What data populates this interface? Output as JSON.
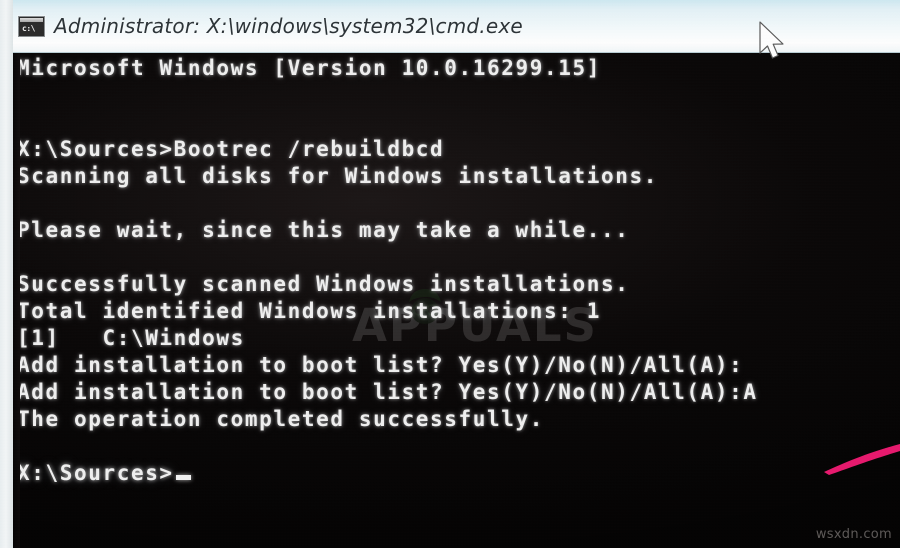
{
  "window": {
    "title": "Administrator: X:\\windows\\system32\\cmd.exe",
    "icon": "cmd-console-icon",
    "icon_prompt_glyph": "c:\\",
    "titlebar_color": "#eef7fa",
    "console_background": "#070505",
    "console_text_color": "#f0f0f0"
  },
  "console": {
    "lines": [
      {
        "text": "Microsoft Windows [Version 10.0.16299.15]",
        "blank": false
      },
      {
        "text": "",
        "blank": true
      },
      {
        "text": "",
        "blank": true
      },
      {
        "text": "X:\\Sources>Bootrec /rebuildbcd",
        "blank": false
      },
      {
        "text": "Scanning all disks for Windows installations.",
        "blank": false
      },
      {
        "text": "",
        "blank": true
      },
      {
        "text": "Please wait, since this may take a while...",
        "blank": false
      },
      {
        "text": "",
        "blank": true
      },
      {
        "text": "Successfully scanned Windows installations.",
        "blank": false
      },
      {
        "text": "Total identified Windows installations: 1",
        "blank": false
      },
      {
        "text": "[1]   C:\\Windows",
        "blank": false
      },
      {
        "text": "Add installation to boot list? Yes(Y)/No(N)/All(A):",
        "blank": false
      },
      {
        "text": "Add installation to boot list? Yes(Y)/No(N)/All(A):A",
        "blank": false
      },
      {
        "text": "The operation completed successfully.",
        "blank": false
      },
      {
        "text": "",
        "blank": true
      },
      {
        "text": "X:\\Sources>",
        "blank": false,
        "cursor": true
      }
    ]
  },
  "annotations": {
    "pink_stroke_color": "#e8196e",
    "pink_stroke_name": "highlight-stroke"
  },
  "watermarks": {
    "center": "APPUALS",
    "corner": "wsxdn.com"
  },
  "cursor": {
    "type": "arrow-pointer"
  }
}
